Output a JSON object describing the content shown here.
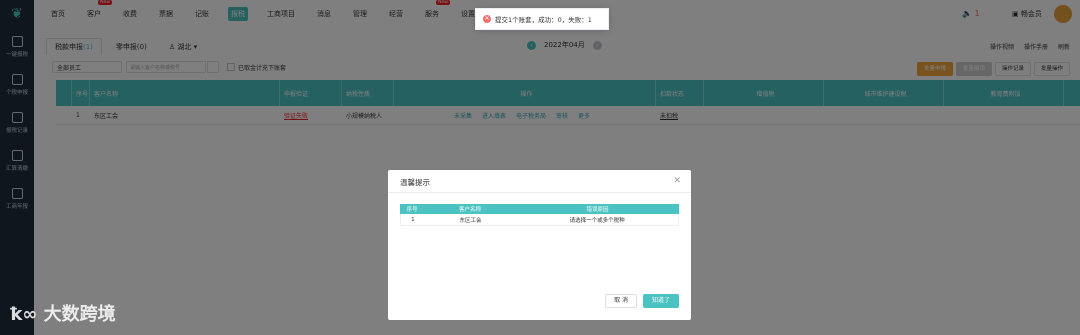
{
  "sidebar": {
    "items": [
      {
        "label": "一键报税"
      },
      {
        "label": "个税申报"
      },
      {
        "label": "报税记录"
      },
      {
        "label": "汇算清缴"
      },
      {
        "label": "工商年报"
      }
    ]
  },
  "nav": {
    "items": [
      {
        "label": "首页"
      },
      {
        "label": "客户",
        "badge": "New"
      },
      {
        "label": "收费"
      },
      {
        "label": "票据"
      },
      {
        "label": "记账"
      },
      {
        "label": "报税",
        "active": true
      },
      {
        "label": "工商项目"
      },
      {
        "label": "消息"
      },
      {
        "label": "管理"
      },
      {
        "label": "经营"
      },
      {
        "label": "服务",
        "badge": "New"
      },
      {
        "label": "设置"
      }
    ]
  },
  "toast": {
    "text": "提交1个账套，成功：0，失败：1"
  },
  "header_right": {
    "bell_count": "1",
    "member": "畅会员"
  },
  "tabs": [
    {
      "label": "税款申报",
      "count": "(1)",
      "active": true
    },
    {
      "label": "零申报",
      "count": "(0)"
    },
    {
      "label": "湖北"
    }
  ],
  "period": {
    "label": "2022年04月"
  },
  "tools": [
    "操作视频",
    "操作手册",
    "刷新"
  ],
  "filters": {
    "staff": "全部员工",
    "search_placeholder": "请输入客户名称或税号",
    "check_label": "已取金计充下账套"
  },
  "actions": [
    "批量申报",
    "批量撤销",
    "操作记录",
    "批量操作"
  ],
  "table": {
    "headers": [
      "序号",
      "客户名称",
      "申报验证",
      "纳税性质",
      "操作",
      "扣款状态",
      "增值税",
      "城市维护建设税",
      "教育费附加"
    ],
    "sub_headers": [
      "填写",
      "申报",
      "缴费"
    ],
    "row": {
      "no": "1",
      "name": "东区工会",
      "verify": "验证失败",
      "nature": "小规模纳税人",
      "ops": [
        "未采集",
        "进入填表",
        "电子税务局",
        "审核",
        "更多"
      ],
      "status": "未扣税"
    }
  },
  "dialog": {
    "title": "温馨提示",
    "headers": [
      "序号",
      "客户名称",
      "错误原因"
    ],
    "rows": [
      {
        "no": "1",
        "name": "东区工会",
        "reason": "请选择一个或多个税种"
      }
    ],
    "cancel": "取 消",
    "ok": "知道了"
  },
  "watermark": "大数跨境"
}
